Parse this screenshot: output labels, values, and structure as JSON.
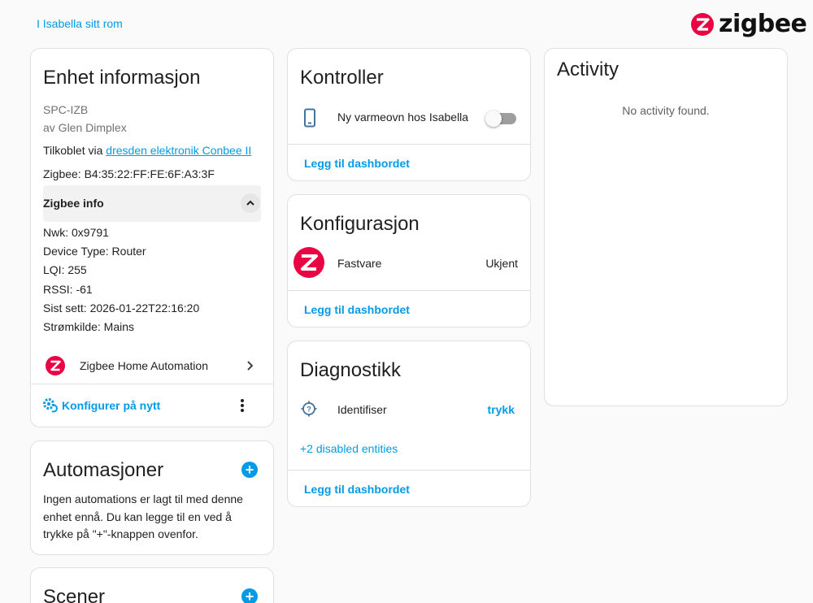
{
  "breadcrumb": "I Isabella sitt rom",
  "brand": {
    "name": "zigbee",
    "color": "#eb0443"
  },
  "device_info": {
    "title": "Enhet informasjon",
    "model": "SPC-IZB",
    "manufacturer": "av Glen Dimplex",
    "connected_prefix": "Tilkoblet via",
    "connected_link": "dresden elektronik Conbee II",
    "zigbee_address": "Zigbee: B4:35:22:FF:FE:6F:A3:3F",
    "zigbee_info_title": "Zigbee info",
    "nwk": "Nwk: 0x9791",
    "device_type": "Device Type: Router",
    "lqi": "LQI: 255",
    "rssi": "RSSI: -61",
    "last_seen": "Sist sett: 2026-01-22T22:16:20",
    "power_source": "Strømkilde: Mains",
    "integration": "Zigbee Home Automation",
    "reconfigure": "Konfigurer på nytt"
  },
  "automations": {
    "title": "Automasjoner",
    "empty_text": "Ingen automations er lagt til med denne enhet ennå. Du kan legge til en ved å trykke på \"+\"-knappen ovenfor."
  },
  "scenes": {
    "title": "Scener"
  },
  "controls": {
    "title": "Kontroller",
    "entity_name": "Ny varmeovn hos Isabella",
    "entity_state": "off",
    "add_to_dashboard": "Legg til dashbordet"
  },
  "configuration": {
    "title": "Konfigurasjon",
    "entity_name": "Fastvare",
    "entity_value": "Ukjent",
    "add_to_dashboard": "Legg til dashbordet"
  },
  "diagnostics": {
    "title": "Diagnostikk",
    "entity_name": "Identifiser",
    "action": "trykk",
    "disabled_entities": "+2 disabled entities",
    "add_to_dashboard": "Legg til dashbordet"
  },
  "activity": {
    "title": "Activity",
    "empty_text": "No activity found."
  }
}
